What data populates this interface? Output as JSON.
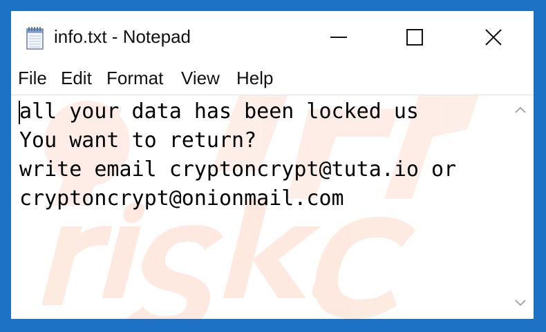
{
  "window": {
    "title": "info.txt - Notepad"
  },
  "menu": {
    "items": [
      "File",
      "Edit",
      "Format",
      "View",
      "Help"
    ]
  },
  "editor": {
    "lines": [
      "all your data has been locked us",
      "You want to return?",
      "write email cryptoncrypt@tuta.io or",
      "cryptoncrypt@onionmail.com"
    ]
  },
  "colors": {
    "desktop_background": "#1d72c6",
    "window_background": "#ffffff",
    "text": "#000000"
  },
  "icons": {
    "app": "notepad-icon",
    "minimize": "minimize-icon",
    "maximize": "maximize-icon",
    "close": "close-icon",
    "scroll_up": "chevron-up-icon",
    "scroll_down": "chevron-down-icon"
  }
}
